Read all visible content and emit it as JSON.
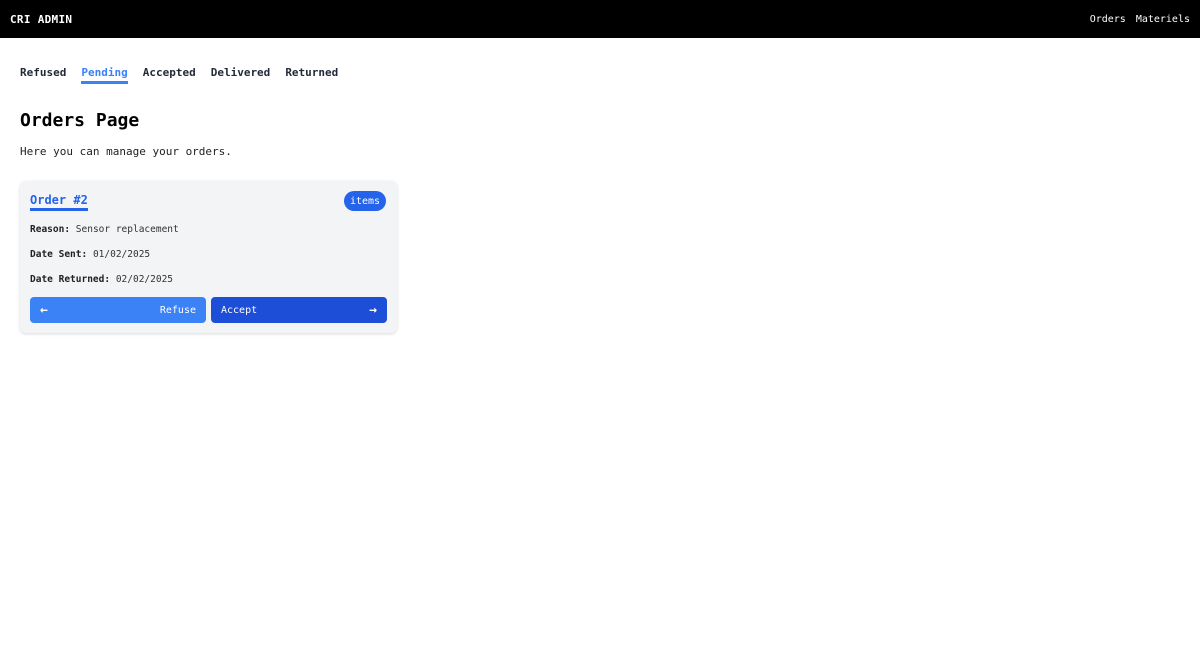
{
  "header": {
    "brand": "CRI ADMIN",
    "links": [
      {
        "label": "Orders"
      },
      {
        "label": "Materiels"
      }
    ]
  },
  "tabs": [
    {
      "label": "Refused",
      "active": false
    },
    {
      "label": "Pending",
      "active": true
    },
    {
      "label": "Accepted",
      "active": false
    },
    {
      "label": "Delivered",
      "active": false
    },
    {
      "label": "Returned",
      "active": false
    }
  ],
  "page": {
    "title": "Orders Page",
    "subtitle": "Here you can manage your orders."
  },
  "order": {
    "title": "Order #2",
    "badge": "items",
    "reason_label": "Reason:",
    "reason": "Sensor replacement",
    "date_sent_label": "Date Sent:",
    "date_sent": "01/02/2025",
    "date_returned_label": "Date Returned:",
    "date_returned": "02/02/2025",
    "refuse_label": "Refuse",
    "accept_label": "Accept",
    "refuse_icon": "←",
    "accept_icon": "→"
  },
  "colors": {
    "navbar": "#000000",
    "accent": "#2563eb",
    "refuse_button": "#3b82f6",
    "accept_button": "#1d4ed8",
    "card_background": "#f3f4f6"
  }
}
